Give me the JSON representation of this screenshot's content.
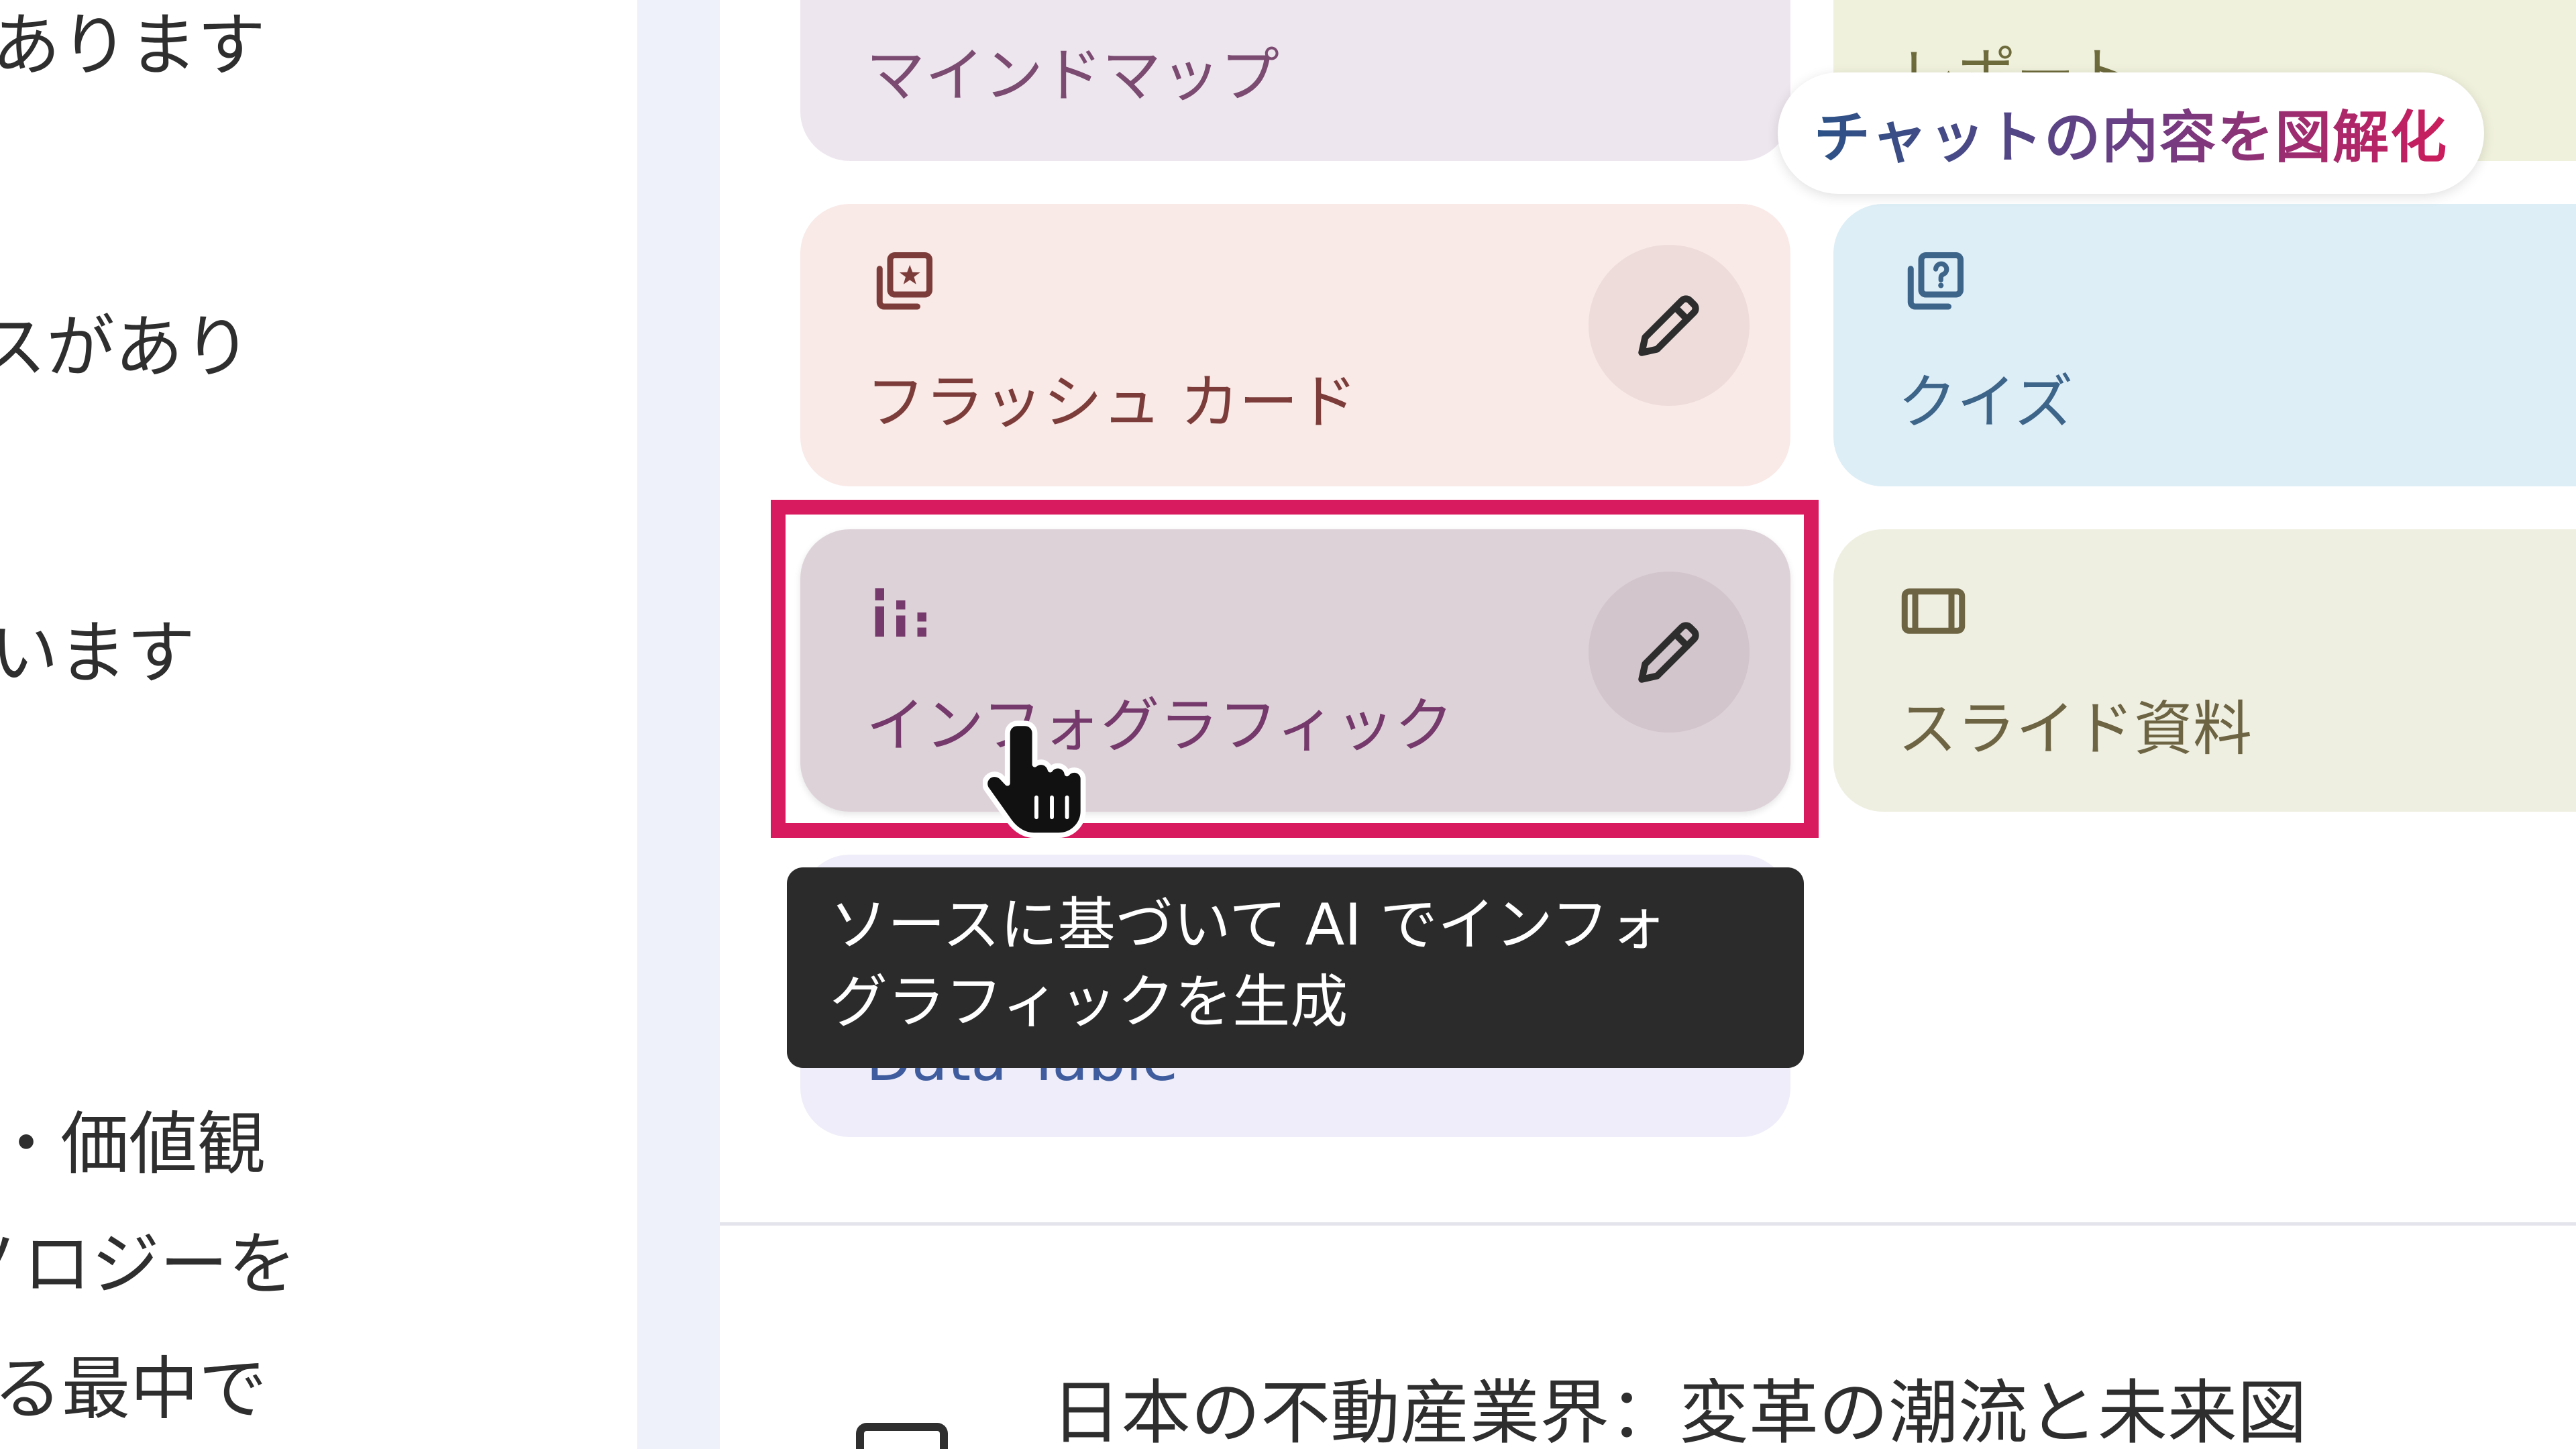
{
  "chat": {
    "fragments": [
      "あります",
      "スがあり",
      "います",
      "・価値観",
      "ノロジーを",
      "る最中で"
    ]
  },
  "studio": {
    "cards": [
      {
        "label": "マインドマップ",
        "bg": "#EEE6EE",
        "fg": "#7B4B72"
      },
      {
        "label": "レポート",
        "bg": "#F0F1DC",
        "fg": "#6D6A3C"
      },
      {
        "label": "フラッシュ カード",
        "icon": "flashcards-icon",
        "edit_icon": "pencil-icon",
        "bg": "#F9E9E7",
        "fg": "#7C3D3A"
      },
      {
        "label": "クイズ",
        "icon": "quiz-icon",
        "bg": "#DDEEF6",
        "fg": "#3D6489"
      },
      {
        "label": "インフォグラフィック",
        "icon": "infographic-icon",
        "edit_icon": "pencil-icon",
        "hovered": true,
        "bg": "#DED2D9",
        "fg": "#753A6B"
      },
      {
        "label": "スライド資料",
        "icon": "slides-icon",
        "bg": "#EFEFE1",
        "fg": "#6D6443"
      },
      {
        "label": "Data Table",
        "bg": "#EEEDF9",
        "fg": "#3E5C9E"
      }
    ]
  },
  "callout": {
    "text": "チャットの内容を図解化",
    "gradient": [
      "#2B5287",
      "#6A3F85",
      "#CC1C5C"
    ]
  },
  "tooltip": {
    "lines": [
      "ソースに基づいて AI でインフォ",
      "グラフィックを生成"
    ]
  },
  "note": {
    "icon": "note-icon",
    "title": "日本の不動産業界：変革の潮流と未来図"
  },
  "cursor": {
    "icon": "hand-pointer-icon"
  },
  "colors": {
    "highlight": "#D81B5E",
    "divider_strip": "#EEF0FA",
    "tooltip_bg": "#2B2B2B",
    "text": "#2E2E2E"
  }
}
